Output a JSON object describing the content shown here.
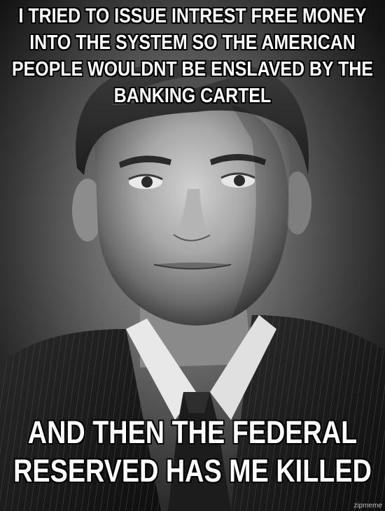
{
  "meme": {
    "top_text": "I TRIED TO ISSUE INTREST FREE MONEY INTO THE SYSTEM SO THE AMERICAN PEOPLE WOULDNT BE ENSLAVED BY THE BANKING CARTEL",
    "bottom_text": "AND THEN THE FEDERAL RESERVED HAS ME KILLED",
    "watermark": "zipmeme"
  },
  "colors": {
    "caption_fill": "#ffffff",
    "caption_outline": "#000000",
    "photo_tone": "grayscale"
  }
}
